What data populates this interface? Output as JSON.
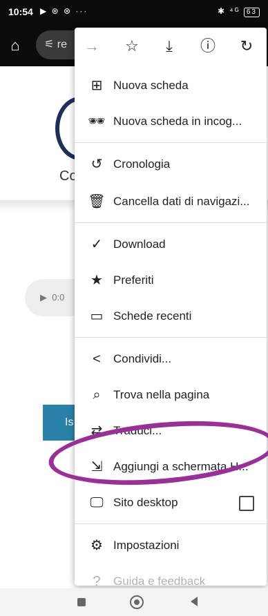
{
  "status": {
    "time": "10:54",
    "left_icons": "▶ ⊛ ⊛ ···",
    "right_icons": "✱ ⁴ᴳ",
    "battery": "63"
  },
  "toolbar": {
    "home_icon": "home-icon",
    "url_text": "re"
  },
  "page": {
    "visible_text": "Co",
    "audio_time": "0:0",
    "button_text": "Is"
  },
  "menu": {
    "top_row": [
      "back-forward-icon",
      "star-icon",
      "download-icon",
      "info-icon",
      "reload-icon"
    ],
    "items": [
      {
        "label": "Nuova scheda",
        "icon": "new-tab-icon"
      },
      {
        "label": "Nuova scheda in incog...",
        "icon": "incognito-icon"
      },
      {
        "label": "Cronologia",
        "icon": "history-icon"
      },
      {
        "label": "Cancella dati di navigazi...",
        "icon": "trash-icon"
      },
      {
        "label": "Download",
        "icon": "download-icon"
      },
      {
        "label": "Preferiti",
        "icon": "star-icon"
      },
      {
        "label": "Schede recenti",
        "icon": "recent-tabs-icon"
      },
      {
        "label": "Condividi...",
        "icon": "share-icon"
      },
      {
        "label": "Trova nella pagina",
        "icon": "find-in-page-icon"
      },
      {
        "label": "Traduci...",
        "icon": "translate-icon"
      },
      {
        "label": "Aggiungi a schermata H...",
        "icon": "add-to-home-icon"
      },
      {
        "label": "Sito desktop",
        "icon": "desktop-icon"
      },
      {
        "label": "Impostazioni",
        "icon": "settings-icon"
      },
      {
        "label": "Guida e feedback",
        "icon": "help-icon"
      }
    ]
  },
  "annotation": {
    "color": "#9b2f9a"
  }
}
